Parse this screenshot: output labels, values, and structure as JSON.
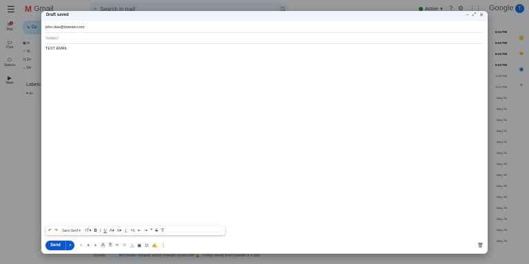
{
  "gmail": {
    "brand": "Gmail",
    "search_placeholder": "Search in mail",
    "status": "Active",
    "google": "Google",
    "avatar_initial": "T",
    "rail": [
      {
        "label": "Mail",
        "icon": "mail-icon",
        "badge": "4"
      },
      {
        "label": "Chat",
        "icon": "chat-icon"
      },
      {
        "label": "Spaces",
        "icon": "spaces-icon"
      },
      {
        "label": "Meet",
        "icon": "meet-icon"
      }
    ],
    "compose_label": "Co",
    "nav_items": [
      "In",
      "St",
      "Sn",
      "Mo"
    ],
    "labels_heading": "Labels",
    "label_item": "su",
    "times": [
      "6:24 PM",
      "6:03 PM",
      "6:03 PM",
      "6:03 PM",
      "4:18 PM",
      "4:24 PM",
      "May 31",
      "May 31",
      "May 31",
      "May 31",
      "May 31",
      "May 31",
      "May 30",
      "May 30",
      "May 30",
      "May 30",
      "May 29",
      "May 29",
      "May 29",
      "May 29"
    ],
    "bottom_row": {
      "sender": "Shoubo",
      "tag": "Bot Hadden",
      "text": "Instantly unlock LinkedIn contact info 🔓 - Collect emails from LinkedIn in a click"
    }
  },
  "compose": {
    "title": "Draft saved",
    "to_value": "john.doe@domain.com",
    "subject_placeholder": "Subject",
    "body": "TEST EMAIL",
    "font": "Sans Serif",
    "send_label": "Send"
  }
}
